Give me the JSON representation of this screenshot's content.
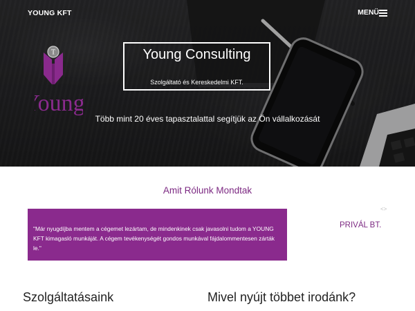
{
  "nav": {
    "brand": "YOUNG KFT",
    "menu_label": "MENÜ"
  },
  "hero": {
    "title": "Young Consulting",
    "subtitle": "Szolgáltató és Kereskedelmi KFT.",
    "tagline": "Több mint 20 éves tapasztalattal segítjük az Ön vállalkozását",
    "logo_text": "Young",
    "logo_letter": "T"
  },
  "testimonials": {
    "title": "Amit Rólunk Mondtak",
    "quote": "\"Már nyugdíjba mentem a cégemet lezártam, de mindenkinek csak javasolni tudom a YOUNG KFT kimagasló munkáját. A cégem tevékenységét gondos munkával fájdalommentesen zárták le.\"",
    "company": "PRIVÁL BT.",
    "arrows": "<>"
  },
  "sections": {
    "services_title": "Szolgáltatásaink",
    "why_title": "Mivel nyújt többet irodánk?"
  },
  "colors": {
    "brand_purple": "#8a2a8d",
    "heading_purple": "#7c2982",
    "hero_bg": "#262628"
  }
}
